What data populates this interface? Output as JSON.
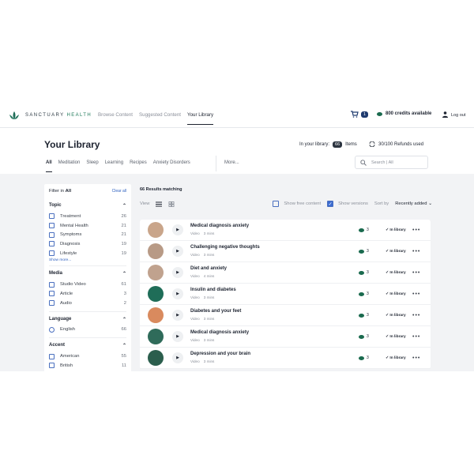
{
  "brand": {
    "name_prefix": "SANCTUARY",
    "name_suffix": " HEALTH"
  },
  "nav": {
    "items": [
      "Browse Content",
      "Suggested Content",
      "Your Library"
    ],
    "active": "Your Library"
  },
  "header": {
    "cart_count": "1",
    "credits": "800 credits available",
    "logout": "Log out"
  },
  "page": {
    "title": "Your Library",
    "in_library_label": "In your library:",
    "in_library_count": "66",
    "items_label": "Items",
    "refunds": "30/100 Refunds used"
  },
  "tabs": [
    "All",
    "Meditation",
    "Sleep",
    "Learning",
    "Recipes",
    "Anxiety Disorders"
  ],
  "more_label": "More...",
  "search": {
    "placeholder": "Search | All"
  },
  "filter": {
    "heading_prefix": "Filter in",
    "heading_value": "All",
    "clear": "Clear all",
    "show_more": "Show more...",
    "sections": [
      {
        "title": "Topic",
        "type": "checkbox",
        "items": [
          {
            "label": "Treatment",
            "count": "26"
          },
          {
            "label": "Mental Health",
            "count": "21"
          },
          {
            "label": "Symptoms",
            "count": "21"
          },
          {
            "label": "Diagnosis",
            "count": "19"
          },
          {
            "label": "Lifestyle",
            "count": "19"
          }
        ]
      },
      {
        "title": "Media",
        "type": "checkbox",
        "items": [
          {
            "label": "Studio Video",
            "count": "61"
          },
          {
            "label": "Article",
            "count": "3"
          },
          {
            "label": "Audio",
            "count": "2"
          }
        ]
      },
      {
        "title": "Language",
        "type": "radio",
        "items": [
          {
            "label": "English",
            "count": "66"
          }
        ]
      },
      {
        "title": "Accent",
        "type": "checkbox",
        "items": [
          {
            "label": "American",
            "count": "55"
          },
          {
            "label": "British",
            "count": "11"
          }
        ]
      }
    ]
  },
  "results": {
    "count_label": "66 Results matching",
    "view_label": "View",
    "show_free": "Show free content",
    "show_versions": "Show versions",
    "sort_label": "Sort by",
    "sort_value": "Recently added"
  },
  "rows": [
    {
      "title": "Medical diagnosis anxiety",
      "type": "Video",
      "duration": "3 mins",
      "credits": "3",
      "status": "In library",
      "thumb": "#c9a58a"
    },
    {
      "title": "Challenging negative thoughts",
      "type": "Video",
      "duration": "3 mins",
      "credits": "3",
      "status": "In library",
      "thumb": "#b89a86"
    },
    {
      "title": "Diet and anxiety",
      "type": "Video",
      "duration": "4 mins",
      "credits": "3",
      "status": "In library",
      "thumb": "#c0a28e"
    },
    {
      "title": "Insulin and diabetes",
      "type": "Video",
      "duration": "3 mins",
      "credits": "3",
      "status": "In library",
      "thumb": "#1f6d58"
    },
    {
      "title": "Diabetes and your feet",
      "type": "Video",
      "duration": "3 mins",
      "credits": "3",
      "status": "In library",
      "thumb": "#d98a5e"
    },
    {
      "title": "Medical diagnosis anxiety",
      "type": "Video",
      "duration": "3 mins",
      "credits": "3",
      "status": "In library",
      "thumb": "#2f6b5a"
    },
    {
      "title": "Depression and your brain",
      "type": "Video",
      "duration": "3 mins",
      "credits": "3",
      "status": "In library",
      "thumb": "#2b5e4d"
    }
  ]
}
